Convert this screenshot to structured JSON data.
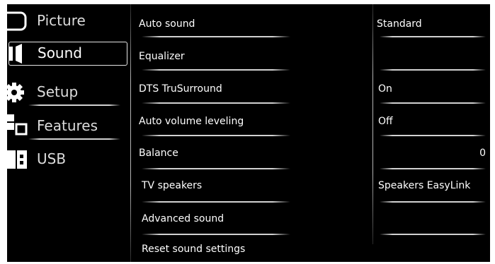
{
  "menu": {
    "items": [
      {
        "label": "Picture",
        "icon": "picture-icon"
      },
      {
        "label": "Sound",
        "icon": "speaker-icon",
        "selected": true
      },
      {
        "label": "Setup",
        "icon": "gear-icon"
      },
      {
        "label": "Features",
        "icon": "features-icon"
      },
      {
        "label": "USB",
        "icon": "usb-icon"
      }
    ]
  },
  "sound_settings": [
    {
      "label": "Auto sound",
      "value": "Standard"
    },
    {
      "label": "Equalizer",
      "value": ""
    },
    {
      "label": "DTS TruSurround",
      "value": "On"
    },
    {
      "label": "Auto volume leveling",
      "value": "Off"
    },
    {
      "label": "Balance",
      "value": "0"
    },
    {
      "label": "TV speakers",
      "value": "Speakers EasyLink"
    },
    {
      "label": "Advanced sound",
      "value": ""
    },
    {
      "label": "Reset sound settings",
      "value": ""
    }
  ],
  "colors": {
    "background": "#000000",
    "text": "#ffffff",
    "frame": "#ffffff"
  }
}
